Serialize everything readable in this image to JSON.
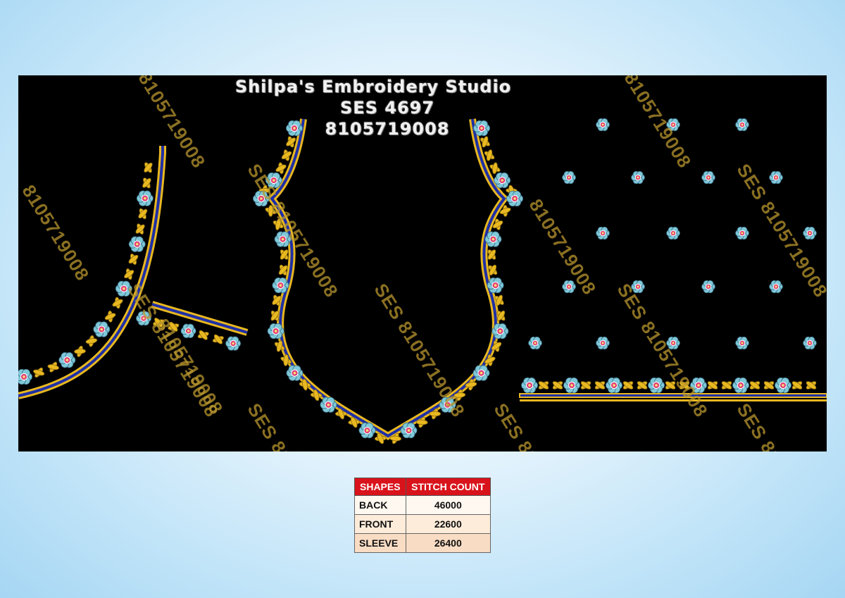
{
  "header": {
    "studio_name": "Shilpa's Embroidery Studio",
    "design_code": "SES 4697",
    "phone": "8105719008"
  },
  "watermark": {
    "phone_text": "8105719008",
    "ses_text": "SES 8105719008",
    "ses_partial_text": "SES 8105"
  },
  "colors": {
    "background": "#000000",
    "gold_leaf": "#e8b820",
    "navy_border": "#1f2fa6",
    "flower_petal": "#7fc8d8",
    "flower_center": "#e0407a",
    "table_header": "#d9131b"
  },
  "stitch_table": {
    "headers": [
      "SHAPES",
      "STITCH COUNT"
    ],
    "rows": [
      {
        "shape": "BACK",
        "count": "46000"
      },
      {
        "shape": "FRONT",
        "count": "22600"
      },
      {
        "shape": "SLEEVE",
        "count": "26400"
      }
    ]
  }
}
